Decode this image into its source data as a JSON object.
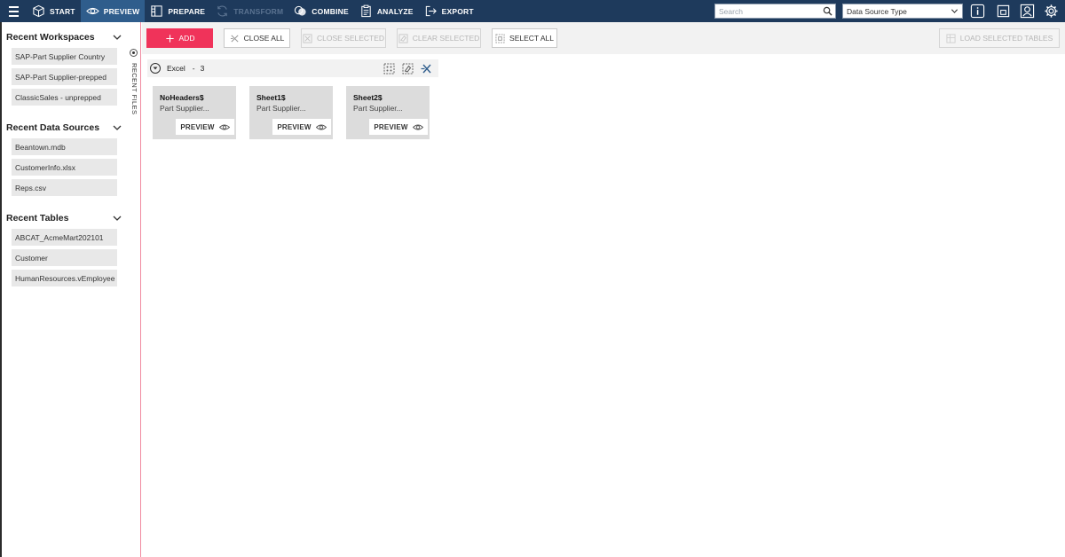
{
  "topbar": {
    "nav": [
      {
        "label": "START",
        "icon": "cube-icon",
        "state": "normal"
      },
      {
        "label": "PREVIEW",
        "icon": "eye-icon",
        "state": "active"
      },
      {
        "label": "PREPARE",
        "icon": "columns-icon",
        "state": "normal"
      },
      {
        "label": "TRANSFORM",
        "icon": "refresh-icon",
        "state": "disabled"
      },
      {
        "label": "COMBINE",
        "icon": "combine-icon",
        "state": "normal"
      },
      {
        "label": "ANALYZE",
        "icon": "clipboard-icon",
        "state": "normal"
      },
      {
        "label": "EXPORT",
        "icon": "export-icon",
        "state": "normal"
      }
    ],
    "search_placeholder": "Search",
    "data_source_type": "Data Source Type",
    "icons": [
      "info-icon",
      "window-icon",
      "user-search-icon",
      "gear-icon"
    ]
  },
  "left_panel": {
    "sections": [
      {
        "title": "Recent Workspaces",
        "items": [
          "SAP-Part Supplier Country",
          "SAP-Part Supplier-prepped",
          "ClassicSales - unprepped"
        ]
      },
      {
        "title": "Recent Data Sources",
        "items": [
          "Beantown.mdb",
          "CustomerInfo.xlsx",
          "Reps.csv"
        ]
      },
      {
        "title": "Recent Tables",
        "items": [
          "ABCAT_AcmeMart202101",
          "Customer",
          "HumanResources.vEmployee"
        ]
      }
    ],
    "strip_label": "RECENT FILES"
  },
  "toolbar": {
    "add": "ADD",
    "close_all": "CLOSE ALL",
    "close_selected": "CLOSE SELECTED",
    "clear_selected": "CLEAR SELECTED",
    "select_all": "SELECT ALL",
    "load_selected_tables": "LOAD SELECTED TABLES"
  },
  "group": {
    "title": "Excel",
    "separator": "-",
    "count": "3",
    "cards": [
      {
        "title": "NoHeaders$",
        "subtitle": "Part Supplier...",
        "preview": "PREVIEW"
      },
      {
        "title": "Sheet1$",
        "subtitle": "Part Supplier...",
        "preview": "PREVIEW"
      },
      {
        "title": "Sheet2$",
        "subtitle": "Part Supplier...",
        "preview": "PREVIEW"
      }
    ]
  },
  "colors": {
    "topbar": "#1e3a5c",
    "active_nav": "#2f5d8c",
    "accent": "#f0335a"
  }
}
